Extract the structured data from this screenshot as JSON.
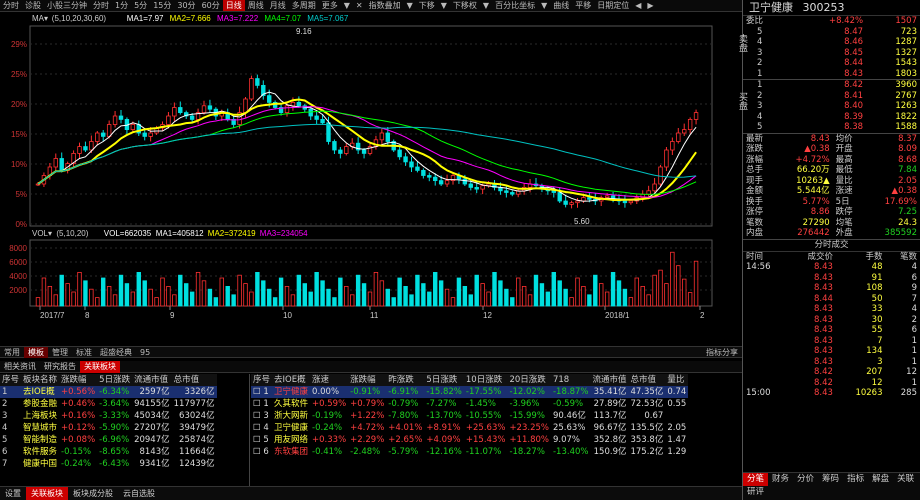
{
  "toolbar": {
    "items": [
      "分时",
      "诊股",
      "小股三分钟",
      "分时",
      "1分",
      "5分",
      "15分",
      "30分",
      "60分",
      "日线",
      "周线",
      "月线",
      "多周期",
      "更多",
      "▼",
      "",
      "✕",
      "",
      "",
      "",
      "",
      "",
      "",
      "",
      "",
      "",
      "",
      "",
      "",
      "",
      "",
      "指数叠加",
      "▼",
      "下移",
      "▼",
      "下移权",
      "▼",
      "百分比坐标",
      "▼",
      "曲线",
      "平移",
      "日期定位",
      "◀",
      "▶"
    ],
    "active": "日线"
  },
  "indicators": {
    "ma_label": "MA▾",
    "ma_params": "(5,10,20,30,60)",
    "ma1": "MA1=7.97",
    "ma2": "MA2=7.666",
    "ma3": "MA3=7.222",
    "ma4": "MA4=7.07",
    "ma5": "MA5=7.067",
    "vol_label": "VOL▾",
    "vol_params": "(5,10,20)",
    "vol": "VOL=662035",
    "vma1": "MA1=405812",
    "vma2": "MA2=372419",
    "vma3": "MA3=234054"
  },
  "chart_data": {
    "type": "candlestick",
    "y_ticks": [
      "29%",
      "25%",
      "20%",
      "15%",
      "10%",
      "5%",
      "0%"
    ],
    "y_ticks_right": [],
    "vol_ticks": [
      "8000",
      "6000",
      "4000",
      "2000"
    ],
    "x_ticks": [
      "2017/7",
      "8",
      "9",
      "10",
      "11",
      "12",
      "2018/1",
      "2"
    ],
    "annotations": [
      "9.16",
      "5.60"
    ],
    "lines": [
      {
        "name": "MA1",
        "color": "#ffffff"
      },
      {
        "name": "MA2",
        "color": "#ffff00"
      },
      {
        "name": "MA3",
        "color": "#ff00ff"
      },
      {
        "name": "MA4",
        "color": "#00ff00"
      },
      {
        "name": "MA5",
        "color": "#00c0c0"
      }
    ]
  },
  "status_tabs": [
    "常用",
    "模板",
    "管理",
    "标准",
    "超盛经典",
    "95"
  ],
  "status_active": "模板",
  "status_right": "指标分享",
  "panel_tabs": [
    "相关资讯",
    "研究报告",
    "关联板块"
  ],
  "panel_active": "关联板块",
  "left_table": {
    "headers": [
      "序号",
      "板块名称",
      "涨跌幅",
      "5日涨跌",
      "流通市值",
      "总市值"
    ],
    "rows": [
      [
        "1",
        "去IOE概",
        "+0.56%",
        "-6.34%",
        "2597亿",
        "3326亿"
      ],
      [
        "2",
        "参股金融",
        "+0.46%",
        "-3.64%",
        "94155亿",
        "117977亿"
      ],
      [
        "3",
        "上海板块",
        "+0.16%",
        "-3.33%",
        "45034亿",
        "63024亿"
      ],
      [
        "4",
        "智慧城市",
        "+0.12%",
        "-5.90%",
        "27207亿",
        "39479亿"
      ],
      [
        "5",
        "智能制造",
        "+0.08%",
        "-6.96%",
        "20947亿",
        "25874亿"
      ],
      [
        "6",
        "软件服务",
        "-0.15%",
        "-8.65%",
        "8143亿",
        "11664亿"
      ],
      [
        "7",
        "健康中国",
        "-0.24%",
        "-6.43%",
        "9341亿",
        "12439亿"
      ]
    ]
  },
  "right_table": {
    "headers": [
      "序号",
      "去IOE概",
      "涨速",
      "涨跌幅",
      "昨涨跌",
      "5日涨跌",
      "10日涨跌",
      "20日涨跌",
      "718",
      "流通市值",
      "总市值",
      "量比"
    ],
    "rows": [
      [
        "1",
        "卫宁健康",
        "0.00%",
        "-0.91%",
        "-6.91%",
        "-15.82%",
        "-17.55%",
        "-12.02%",
        "-18.87%",
        "35.41亿",
        "47.35亿",
        "0.74"
      ],
      [
        "1",
        "久其软件",
        "+0.59%",
        "+0.79%",
        "-0.79%",
        "-7.27%",
        "-1.45%",
        "-3.96%",
        "-0.59%",
        "27.89亿",
        "72.53亿",
        "0.55"
      ],
      [
        "3",
        "浙大网新",
        "-0.19%",
        "+1.22%",
        "-7.80%",
        "-13.70%",
        "-10.55%",
        "-15.99%",
        "90.46亿",
        "113.7亿",
        "0.67"
      ],
      [
        "4",
        "卫宁健康",
        "-0.24%",
        "+4.72%",
        "+4.01%",
        "+8.91%",
        "+25.63%",
        "+23.25%",
        "25.63%",
        "96.67亿",
        "135.5亿",
        "2.05"
      ],
      [
        "5",
        "用友网络",
        "+0.33%",
        "+2.29%",
        "+2.65%",
        "+4.09%",
        "+15.43%",
        "+11.80%",
        "9.07%",
        "352.8亿",
        "353.8亿",
        "1.47"
      ],
      [
        "6",
        "东软集团",
        "-0.41%",
        "-2.48%",
        "-5.79%",
        "-12.16%",
        "-11.07%",
        "-18.27%",
        "-13.40%",
        "150.9亿",
        "175.2亿",
        "1.29"
      ]
    ]
  },
  "bottom_tabs": [
    "设置",
    "关联板块",
    "板块成分股",
    "云自选股"
  ],
  "bottom_active": "关联板块",
  "side": {
    "name": "卫宁健康",
    "code": "300253",
    "weibi_label": "委比",
    "weibi": "+8.42%",
    "weicha": "1507",
    "sell_label": "卖盘",
    "buy_label": "买盘",
    "asks": [
      [
        "5",
        "8.47",
        "723"
      ],
      [
        "4",
        "8.46",
        "1287"
      ],
      [
        "3",
        "8.45",
        "1327"
      ],
      [
        "2",
        "8.44",
        "1543"
      ],
      [
        "1",
        "8.43",
        "1803"
      ]
    ],
    "bids": [
      [
        "1",
        "8.42",
        "3960"
      ],
      [
        "2",
        "8.41",
        "2767"
      ],
      [
        "3",
        "8.40",
        "1263"
      ],
      [
        "4",
        "8.39",
        "1822"
      ],
      [
        "5",
        "8.38",
        "1588"
      ]
    ],
    "stats": [
      [
        "最新",
        "8.43",
        "均价",
        "8.37"
      ],
      [
        "涨跌",
        "▲0.38",
        "开盘",
        "8.09"
      ],
      [
        "涨幅",
        "+4.72%",
        "最高",
        "8.68"
      ],
      [
        "总手",
        "66.20万",
        "最低",
        "7.84"
      ],
      [
        "现手",
        "10263▲",
        "量比",
        "2.05"
      ],
      [
        "金额",
        "5.544亿",
        "涨速",
        "▲0.38"
      ],
      [
        "换手",
        "5.77%",
        "5日",
        "17.69%"
      ],
      [
        "涨停",
        "8.86",
        "跌停",
        "7.25"
      ],
      [
        "笔数",
        "27290",
        "均笔",
        "24.3"
      ],
      [
        "内盘",
        "276442",
        "外盘",
        "385592"
      ]
    ],
    "ticks_title": "分时成交",
    "ticks_headers": [
      "时间",
      "成交价",
      "手数",
      "笔数"
    ],
    "ticks": [
      [
        "14:56",
        "8.43",
        "48",
        "4"
      ],
      [
        "",
        "8.43",
        "91",
        "6"
      ],
      [
        "",
        "8.43",
        "108",
        "9"
      ],
      [
        "",
        "8.44",
        "50",
        "7"
      ],
      [
        "",
        "8.43",
        "33",
        "4"
      ],
      [
        "",
        "8.43",
        "30",
        "2"
      ],
      [
        "",
        "8.43",
        "55",
        "6"
      ],
      [
        "",
        "8.43",
        "7",
        "1"
      ],
      [
        "",
        "8.43",
        "134",
        "1"
      ],
      [
        "",
        "8.43",
        "3",
        "1"
      ],
      [
        "",
        "8.42",
        "207",
        "12"
      ],
      [
        "",
        "8.42",
        "12",
        "1"
      ],
      [
        "15:00",
        "8.43",
        "10263",
        "285"
      ]
    ],
    "tabs": [
      "分笔",
      "财务",
      "分价",
      "筹码",
      "指标",
      "解盘",
      "关联",
      "研评"
    ],
    "tabs_active": "分笔"
  }
}
